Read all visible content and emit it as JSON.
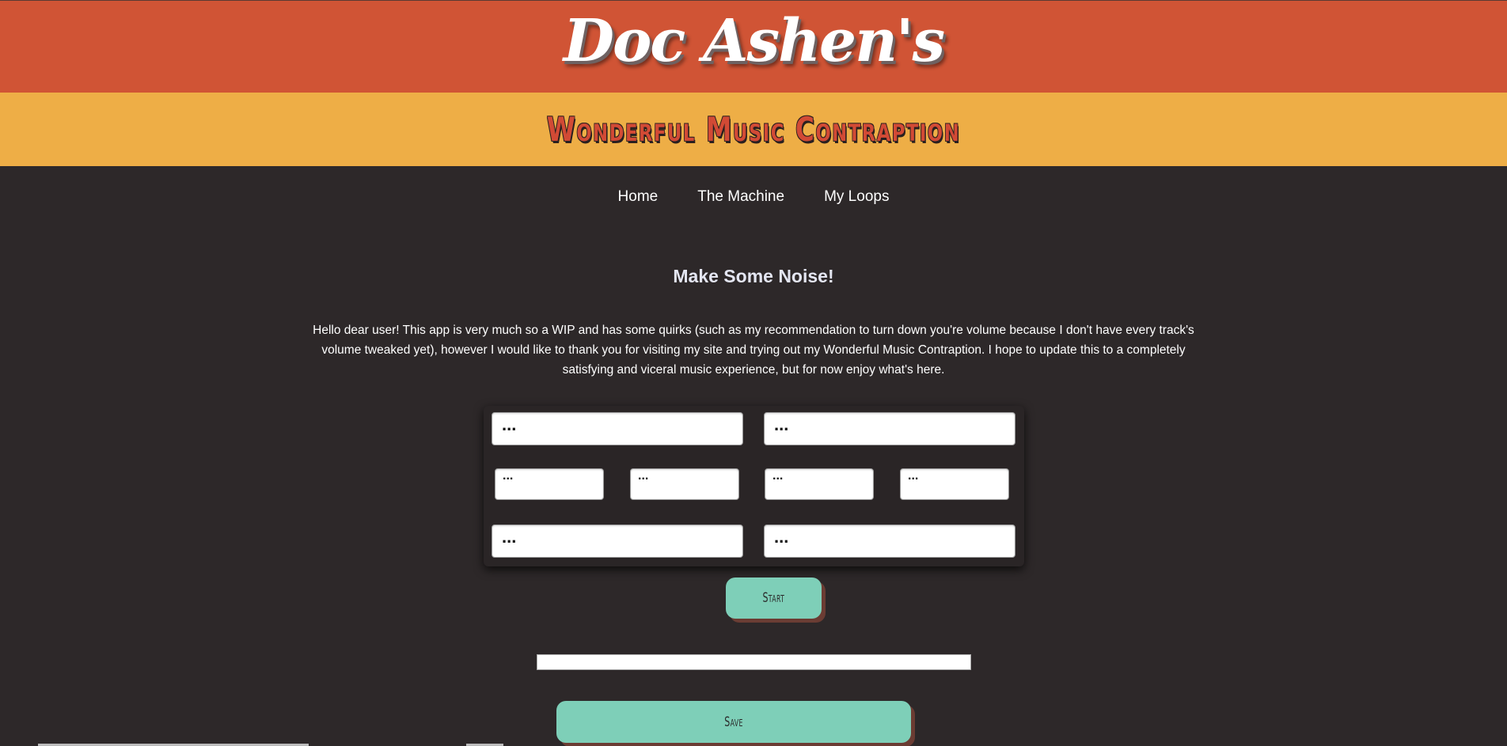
{
  "brand": {
    "title": "Doc Ashen's",
    "subtitle": "Wonderful Music Contraption"
  },
  "nav": {
    "items": [
      "Home",
      "The Machine",
      "My Loops"
    ]
  },
  "main": {
    "heading": "Make Some Noise!",
    "intro": "Hello dear user! This app is very much so a WIP and has some quirks (such as my recommendation to turn down you're volume because I don't have every track's volume tweaked yet), however I would like to thank you for visiting my site and trying out my Wonderful Music Contraption. I hope to update this to a completely satisfying and viceral music experience, but for now enjoy what's here."
  },
  "form": {
    "fields": [
      "...",
      "...",
      "...",
      "...",
      "...",
      "...",
      "...",
      "..."
    ],
    "start_label": "Start",
    "save_label": "Save"
  },
  "colors": {
    "header": "#d05435",
    "subheader": "#eeae46",
    "background": "#2d2829",
    "accent": "#7ecfb8",
    "shadow": "#6b3c33"
  }
}
